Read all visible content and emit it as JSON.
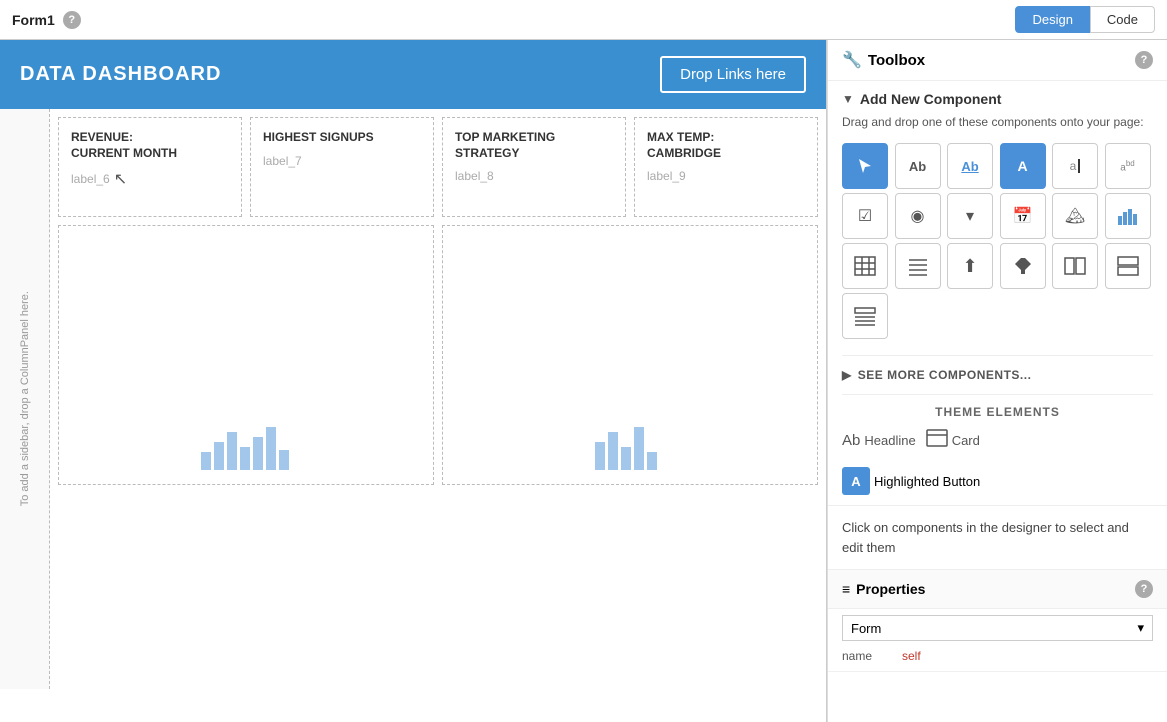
{
  "topbar": {
    "form_title": "Form1",
    "help_icon": "?",
    "tab_design": "Design",
    "tab_code": "Code"
  },
  "designer": {
    "header": {
      "title": "DATA DASHBOARD",
      "drop_links_btn": "Drop Links here"
    },
    "sidebar_placeholder": "To add a sidebar, drop a ColumnPanel here.",
    "stat_cards": [
      {
        "title": "REVENUE:\nCURRENT MONTH",
        "label": "label_6"
      },
      {
        "title": "HIGHEST SIGNUPS",
        "label": "label_7"
      },
      {
        "title": "TOP MARKETING\nSTRATEGY",
        "label": "label_8"
      },
      {
        "title": "MAX TEMP:\nCAMBRIDGE",
        "label": "label_9"
      }
    ]
  },
  "toolbox": {
    "title": "Toolbox",
    "help_icon": "?",
    "add_section_title": "Add New Component",
    "section_desc": "Drag and drop one of these components onto your page:",
    "components": [
      {
        "id": "cursor",
        "icon": "↖",
        "type": "cursor",
        "active": true
      },
      {
        "id": "label-plain",
        "icon": "Ab",
        "type": "text"
      },
      {
        "id": "label-underline",
        "icon": "Ab",
        "type": "text-underline"
      },
      {
        "id": "button-highlight",
        "icon": "A",
        "type": "button-highlight",
        "highlighted": true
      },
      {
        "id": "input-text",
        "icon": "a|",
        "type": "input"
      },
      {
        "id": "input-bd",
        "icon": "a bd",
        "type": "input-bd"
      },
      {
        "id": "checkbox",
        "icon": "☑",
        "type": "checkbox"
      },
      {
        "id": "radio",
        "icon": "◉",
        "type": "radio"
      },
      {
        "id": "dropdown",
        "icon": "▾",
        "type": "dropdown"
      },
      {
        "id": "calendar",
        "icon": "📅",
        "type": "calendar"
      },
      {
        "id": "image",
        "icon": "🖼",
        "type": "image"
      },
      {
        "id": "chart-bar",
        "icon": "📊",
        "type": "chart"
      },
      {
        "id": "table-grid",
        "icon": "⊞",
        "type": "table"
      },
      {
        "id": "table-lines",
        "icon": "☰",
        "type": "table-lines"
      },
      {
        "id": "upload",
        "icon": "⬆",
        "type": "upload"
      },
      {
        "id": "text-align",
        "icon": "⊥",
        "type": "text-align"
      },
      {
        "id": "split-h",
        "icon": "⫿",
        "type": "split-h"
      },
      {
        "id": "split-v",
        "icon": "⊟",
        "type": "split-v"
      },
      {
        "id": "list-text",
        "icon": "≡",
        "type": "list"
      }
    ],
    "see_more_label": "SEE MORE COMPONENTS...",
    "theme_section_title": "THEME ELEMENTS",
    "theme_items": [
      {
        "label": "Headline",
        "icon": "Ab"
      },
      {
        "label": "Card",
        "icon": "▦"
      }
    ],
    "highlighted_button_label": "Highlighted Button",
    "highlighted_button_icon": "A",
    "info_text": "Click on components in the designer to select and edit them",
    "properties_title": "Properties",
    "properties_help": "?",
    "form_section_label": "Form",
    "form_dropdown_arrow": "▾",
    "name_label": "name",
    "name_value": "self"
  }
}
